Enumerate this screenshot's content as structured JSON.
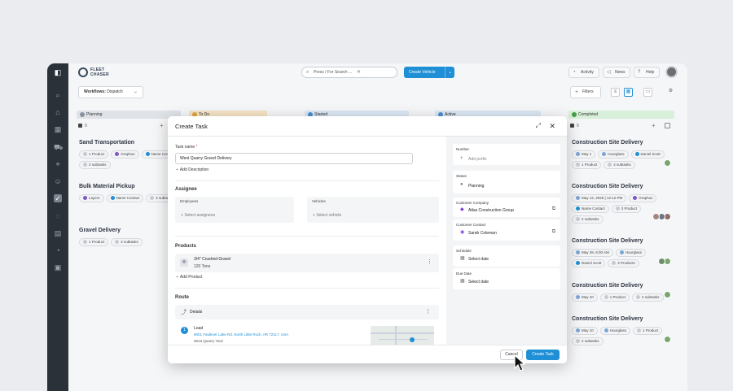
{
  "app": {
    "logo_text": "FLEET\nCHASER"
  },
  "topbar": {
    "search_placeholder": "Press / For Search ...",
    "create_vehicle": "Create Vehicle",
    "activity": "Activity",
    "news": "News",
    "help": "Help"
  },
  "toolbar": {
    "workflow_label": "Workflows:",
    "workflow_value": "Dispatch",
    "filters": "Filters"
  },
  "columns": [
    {
      "name": "Planning",
      "color": "#dfe3e8",
      "dot": "#8a94a0"
    },
    {
      "name": "To Do",
      "color": "#f6e4c6",
      "dot": "#e0a640"
    },
    {
      "name": "Started",
      "color": "#dbe7f4",
      "dot": "#4a8ed0"
    },
    {
      "name": "Active",
      "color": "#dbe7f4",
      "dot": "#4a8ed0"
    },
    {
      "name": "Completed",
      "color": "#d8efd9",
      "dot": "#43a047"
    }
  ],
  "planning": {
    "count": "0",
    "cards": [
      {
        "title": "Sand Transportation",
        "chips": [
          "1 Product",
          "Graphus",
          "Name Contact",
          "2 subtasks"
        ]
      },
      {
        "title": "Bulk Material Pickup",
        "chips": [
          "Layers",
          "Name Contact",
          "2 subtasks"
        ]
      },
      {
        "title": "Gravel Delivery",
        "chips": [
          "1 Product",
          "2 subtasks"
        ]
      }
    ]
  },
  "completed": {
    "count": "0",
    "cards": [
      {
        "title": "Construction Site Delivery",
        "chips": [
          "May 1",
          "Hourglass",
          "Daniel Scott",
          "1 Product",
          "2 subtasks"
        ]
      },
      {
        "title": "Construction Site Delivery",
        "chips": [
          "May 12, 2025 | 12:12 PM",
          "Graphus",
          "Name Contact",
          "3 Product",
          "2 subtasks"
        ]
      },
      {
        "title": "Construction Site Delivery",
        "chips": [
          "May 28, 6:00 AM",
          "Hourglass",
          "Daniel Scott",
          "4 Products"
        ]
      },
      {
        "title": "Construction Site Delivery",
        "chips": [
          "May 10",
          "1 Product",
          "2 subtasks"
        ]
      },
      {
        "title": "Construction Site Delivery",
        "chips": [
          "May 10",
          "Hourglass",
          "1 Product",
          "2 subtasks"
        ]
      }
    ]
  },
  "modal": {
    "title": "Create Task",
    "task_name_label": "Task name",
    "task_name_required": "*",
    "task_name_value": "West Quarry Gravel Delivery",
    "add_description": "Add Description",
    "assignee_section": "Assignee",
    "employees_label": "Employees",
    "employees_placeholder": "Select assignees",
    "vehicles_label": "Vehicles",
    "vehicles_placeholder": "Select vehicle",
    "products_section": "Products",
    "product_name": "3/4\" Crushed Gravel",
    "product_qty": "120 Tons",
    "add_product": "Add Product",
    "route_section": "Route",
    "route_details": "Details",
    "stop_number": "1",
    "stop_type": "Load",
    "stop_address": "9001 Faulkner Lake Rd, North Little Rock, AR 72117, USA",
    "stop_name": "West Quarry Yard",
    "number_label": "Number",
    "add_prefix": "Add prefix",
    "status_label": "Status",
    "status_value": "Planning",
    "customer_company_label": "Customer Company",
    "customer_company_value": "Atlas Construction Group",
    "customer_contact_label": "Customer Contact",
    "customer_contact_value": "Sarah Coleman",
    "schedule_label": "Schedule",
    "schedule_placeholder": "Select date",
    "due_date_label": "Due Date",
    "due_date_placeholder": "Select date",
    "cancel": "Cancel",
    "create": "Create Task"
  }
}
